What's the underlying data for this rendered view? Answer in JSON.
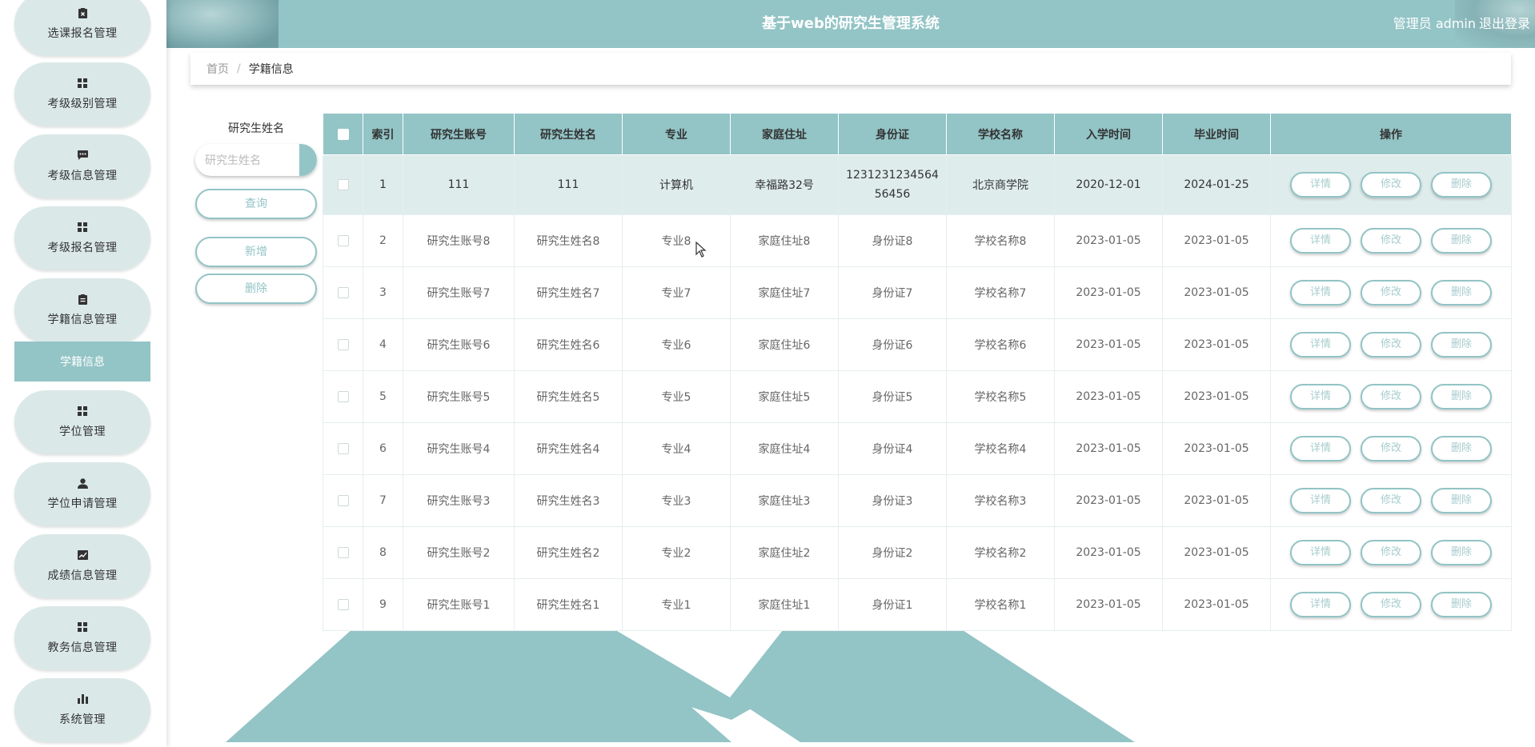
{
  "header": {
    "title": "基于web的研究生管理系统",
    "user": "管理员 admin",
    "logout": "退出登录"
  },
  "sidebar": {
    "items": [
      {
        "label": "选课报名管理",
        "icon": "clipboard-x-icon"
      },
      {
        "label": "考级级别管理",
        "icon": "grid-icon"
      },
      {
        "label": "考级信息管理",
        "icon": "message-icon"
      },
      {
        "label": "考级报名管理",
        "icon": "grid-icon"
      },
      {
        "label": "学籍信息管理",
        "icon": "clipboard-icon"
      },
      {
        "label": "学位管理",
        "icon": "grid-icon"
      },
      {
        "label": "学位申请管理",
        "icon": "user-icon"
      },
      {
        "label": "成绩信息管理",
        "icon": "chart-line-icon"
      },
      {
        "label": "教务信息管理",
        "icon": "grid-icon"
      },
      {
        "label": "系统管理",
        "icon": "bar-chart-icon"
      }
    ],
    "active_sub": "学籍信息"
  },
  "breadcrumb": {
    "home": "首页",
    "separator": "/",
    "current": "学籍信息"
  },
  "search": {
    "label": "研究生姓名",
    "placeholder": "研究生姓名",
    "query_button": "查询",
    "add_button": "新增",
    "delete_button": "删除"
  },
  "table": {
    "columns": [
      "索引",
      "研究生账号",
      "研究生姓名",
      "专业",
      "家庭住址",
      "身份证",
      "学校名称",
      "入学时间",
      "毕业时间",
      "操作"
    ],
    "rows": [
      {
        "index": "1",
        "account": "111",
        "name": "111",
        "major": "计算机",
        "address": "幸福路32号",
        "id_line1": "1231231234564",
        "id_line2": "56456",
        "school": "北京商学院",
        "enroll": "2020-12-01",
        "graduate": "2024-01-25"
      },
      {
        "index": "2",
        "account": "研究生账号8",
        "name": "研究生姓名8",
        "major": "专业8",
        "address": "家庭住址8",
        "id": "身份证8",
        "school": "学校名称8",
        "enroll": "2023-01-05",
        "graduate": "2023-01-05"
      },
      {
        "index": "3",
        "account": "研究生账号7",
        "name": "研究生姓名7",
        "major": "专业7",
        "address": "家庭住址7",
        "id": "身份证7",
        "school": "学校名称7",
        "enroll": "2023-01-05",
        "graduate": "2023-01-05"
      },
      {
        "index": "4",
        "account": "研究生账号6",
        "name": "研究生姓名6",
        "major": "专业6",
        "address": "家庭住址6",
        "id": "身份证6",
        "school": "学校名称6",
        "enroll": "2023-01-05",
        "graduate": "2023-01-05"
      },
      {
        "index": "5",
        "account": "研究生账号5",
        "name": "研究生姓名5",
        "major": "专业5",
        "address": "家庭住址5",
        "id": "身份证5",
        "school": "学校名称5",
        "enroll": "2023-01-05",
        "graduate": "2023-01-05"
      },
      {
        "index": "6",
        "account": "研究生账号4",
        "name": "研究生姓名4",
        "major": "专业4",
        "address": "家庭住址4",
        "id": "身份证4",
        "school": "学校名称4",
        "enroll": "2023-01-05",
        "graduate": "2023-01-05"
      },
      {
        "index": "7",
        "account": "研究生账号3",
        "name": "研究生姓名3",
        "major": "专业3",
        "address": "家庭住址3",
        "id": "身份证3",
        "school": "学校名称3",
        "enroll": "2023-01-05",
        "graduate": "2023-01-05"
      },
      {
        "index": "8",
        "account": "研究生账号2",
        "name": "研究生姓名2",
        "major": "专业2",
        "address": "家庭住址2",
        "id": "身份证2",
        "school": "学校名称2",
        "enroll": "2023-01-05",
        "graduate": "2023-01-05"
      },
      {
        "index": "9",
        "account": "研究生账号1",
        "name": "研究生姓名1",
        "major": "专业1",
        "address": "家庭住址1",
        "id": "身份证1",
        "school": "学校名称1",
        "enroll": "2023-01-05",
        "graduate": "2023-01-05"
      }
    ],
    "actions": {
      "detail": "详情",
      "edit": "修改",
      "delete": "删除"
    }
  },
  "colors": {
    "accent": "#93c4c6",
    "menu_bg": "#dbe8e8",
    "highlight_row": "#dfecec"
  }
}
